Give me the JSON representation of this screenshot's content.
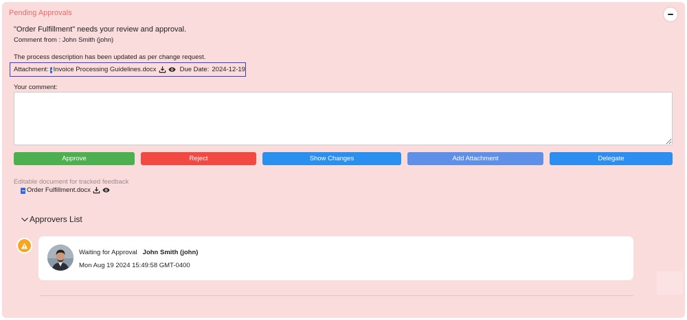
{
  "panel": {
    "title": "Pending Approvals"
  },
  "request": {
    "message": "\"Order Fulfillment\" needs your review and approval.",
    "comment_from": "Comment from : John Smith (john)",
    "description": "The process description has been updated as per change request."
  },
  "attachment": {
    "label": "Attachment:",
    "file_name": "Invoice Processing Guidelines.docx",
    "due_label": "Due Date:",
    "due_date": "2024-12-19"
  },
  "comment": {
    "label": "Your comment:",
    "value": "",
    "placeholder": ""
  },
  "actions": {
    "approve": "Approve",
    "reject": "Reject",
    "show_changes": "Show Changes",
    "add_attachment": "Add Attachment",
    "delegate": "Delegate"
  },
  "editable": {
    "label": "Editable document for tracked feedback",
    "file_name": "Order Fulfillment.docx"
  },
  "approvers": {
    "header": "Approvers List",
    "items": [
      {
        "status": "Waiting for Approval",
        "name": "John Smith (john)",
        "date": "Mon Aug 19 2024 15:49:58 GMT-0400"
      }
    ]
  },
  "colors": {
    "panel_bg": "#fbdcdc",
    "title": "#f06a6a",
    "approve": "#4caf50",
    "reject": "#f24a42",
    "show_changes": "#2990f0",
    "add_attachment": "#5d90e6",
    "delegate": "#2b8ef0",
    "pending_dot": "#f5a623",
    "highlight_border": "#3b3bd9"
  },
  "icons": {
    "collapse": "minus-icon",
    "file": "document-icon",
    "download": "download-icon",
    "view": "eye-icon",
    "chevron": "chevron-down-icon",
    "warning": "warning-icon"
  }
}
